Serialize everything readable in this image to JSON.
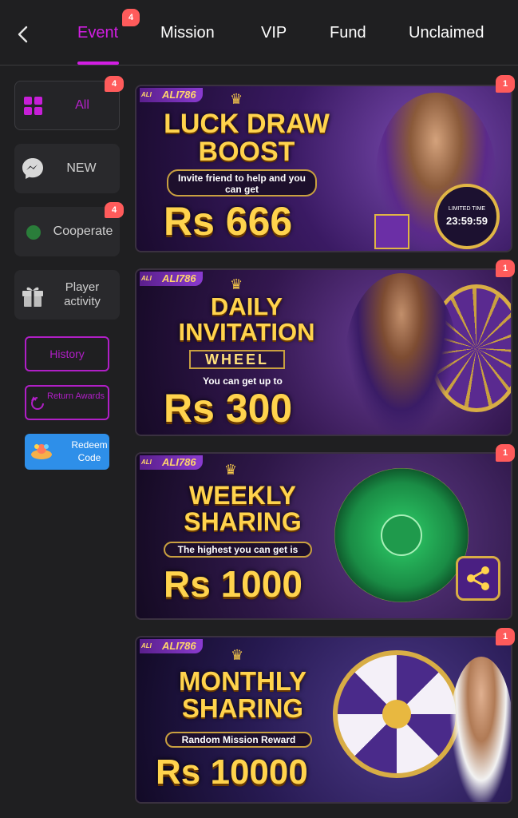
{
  "topbar": {
    "tabs": [
      {
        "label": "Event",
        "active": true,
        "badge": "4"
      },
      {
        "label": "Mission"
      },
      {
        "label": "VIP"
      },
      {
        "label": "Fund"
      },
      {
        "label": "Unclaimed"
      }
    ]
  },
  "sidebar": {
    "items": [
      {
        "label": "All",
        "badge": "4",
        "active": true,
        "icon": "grid-icon"
      },
      {
        "label": "NEW",
        "icon": "messenger-icon"
      },
      {
        "label": "Cooperate",
        "badge": "4",
        "icon": "cooperate-icon"
      },
      {
        "label": "Player activity",
        "icon": "gift-icon"
      }
    ],
    "history_label": "History",
    "return_label": "Return Awards",
    "redeem_label": "Redeem Code"
  },
  "banners": [
    {
      "brand": "ALI786",
      "title_lines": [
        "LUCK DRAW",
        "BOOST"
      ],
      "subtitle": "Invite friend to help and you can get",
      "amount": "Rs 666",
      "timer_label": "LIMITED TIME",
      "timer": "23:59:59",
      "badge": "1"
    },
    {
      "brand": "ALI786",
      "title_lines": [
        "DAILY",
        "INVITATION"
      ],
      "title_sub": "WHEEL",
      "subtitle": "You can get up to",
      "amount": "Rs 300",
      "badge": "1"
    },
    {
      "brand": "ALI786",
      "title_lines": [
        "WEEKLY",
        "SHARING"
      ],
      "subtitle": "The highest you can get is",
      "amount": "Rs 1000",
      "badge": "1"
    },
    {
      "brand": "ALI786",
      "title_lines": [
        "MONTHLY",
        "SHARING"
      ],
      "subtitle": "Random Mission Reward",
      "amount": "Rs 10000",
      "badge": "1"
    }
  ],
  "colors": {
    "accent": "#d21ee3",
    "badge": "#ff5b5b",
    "gold": "#ffd34d",
    "background": "#1f1f21"
  }
}
